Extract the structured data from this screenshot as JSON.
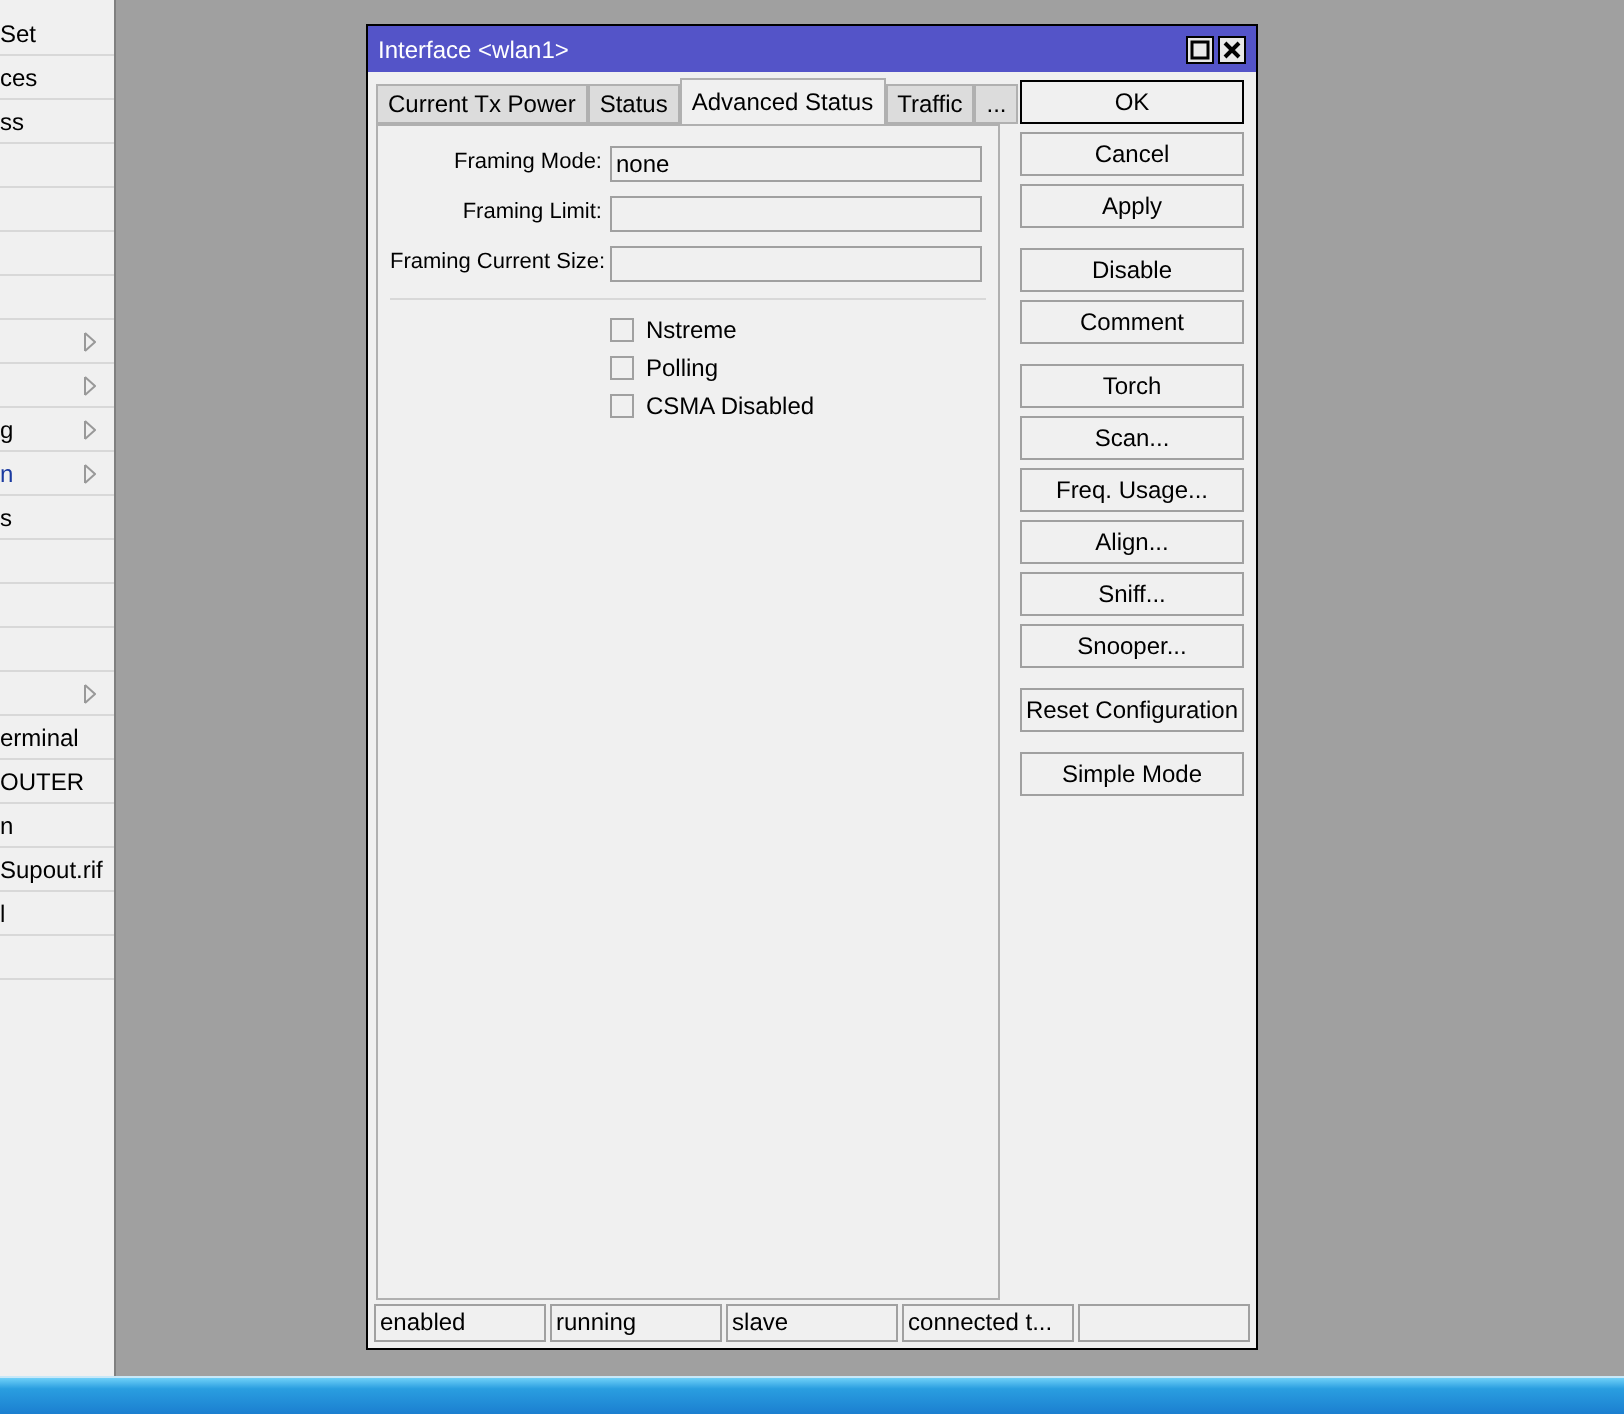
{
  "sidebar": {
    "items": [
      {
        "label": "Set",
        "submenu": false
      },
      {
        "label": "ces",
        "submenu": false
      },
      {
        "label": "ss",
        "submenu": false
      },
      {
        "submenu": false
      },
      {
        "submenu": false
      },
      {
        "submenu": false
      },
      {
        "submenu": false
      },
      {
        "submenu": true
      },
      {
        "submenu": true
      },
      {
        "label": "g",
        "submenu": true
      },
      {
        "label": "n",
        "submenu": true,
        "color": "#1a3aa0"
      },
      {
        "label": "s",
        "submenu": false
      },
      {
        "submenu": false
      },
      {
        "submenu": false
      },
      {
        "submenu": false
      },
      {
        "submenu": true
      },
      {
        "label": "erminal",
        "submenu": false
      },
      {
        "label": "OUTER",
        "submenu": false
      },
      {
        "label": "n",
        "submenu": false
      },
      {
        "label": "Supout.rif",
        "submenu": false
      },
      {
        "label": "l",
        "submenu": false
      },
      {
        "submenu": false
      }
    ]
  },
  "dialog": {
    "title": "Interface <wlan1>",
    "tabs": [
      {
        "label": "Current Tx Power",
        "selected": false
      },
      {
        "label": "Status",
        "selected": false
      },
      {
        "label": "Advanced Status",
        "selected": true
      },
      {
        "label": "Traffic",
        "selected": false
      },
      {
        "label": "...",
        "selected": false
      }
    ],
    "fields": [
      {
        "label": "Framing Mode:",
        "value": "none"
      },
      {
        "label": "Framing Limit:"
      },
      {
        "label": "Framing Current Size:"
      }
    ],
    "checkboxes": [
      {
        "label": "Nstreme",
        "checked": false
      },
      {
        "label": "Polling",
        "checked": false
      },
      {
        "label": "CSMA Disabled",
        "checked": false
      }
    ],
    "button_groups": [
      [
        "OK",
        "Cancel",
        "Apply"
      ],
      [
        "Disable",
        "Comment"
      ],
      [
        "Torch",
        "Scan...",
        "Freq. Usage...",
        "Align...",
        "Sniff...",
        "Snooper..."
      ],
      [
        "Reset Configuration"
      ],
      [
        "Simple Mode"
      ]
    ],
    "status_bar": [
      "enabled",
      "running",
      "slave",
      "connected t..."
    ]
  }
}
